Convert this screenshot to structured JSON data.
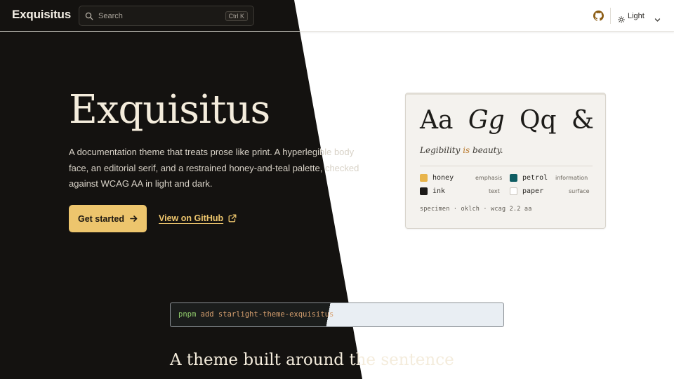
{
  "header": {
    "brand": "Exquisitus",
    "search": {
      "placeholder": "Search",
      "shortcut": "Ctrl K",
      "icon": "search-icon"
    },
    "github_icon": "github-icon",
    "theme_select": {
      "icon": "sun-icon",
      "value": "Light",
      "caret": "chevron-down-icon"
    }
  },
  "hero": {
    "title": "Exquisitus",
    "lede": "A documentation theme that treats prose like print. A hyperlegible body face, an editorial serif, and a restrained honey-and-teal palette, checked against WCAG AA in light and dark.",
    "primary_button": {
      "label": "Get started",
      "icon": "arrow-right-icon"
    },
    "secondary_link": {
      "label": "View on GitHub",
      "icon": "external-link-icon"
    }
  },
  "specimen": {
    "glyphs": [
      "Aa",
      "Gg",
      "Qq",
      "&"
    ],
    "tagline": {
      "pre": "Legibility ",
      "highlight": "is",
      "post": " beauty."
    },
    "swatches": [
      {
        "name": "honey",
        "role": "emphasis",
        "color": "#e8b44a"
      },
      {
        "name": "petrol",
        "role": "information",
        "color": "#0f5d63"
      },
      {
        "name": "ink",
        "role": "text",
        "color": "#1c1b18"
      },
      {
        "name": "paper",
        "role": "surface",
        "color": "#ffffff"
      }
    ],
    "footer": "specimen · oklch · wcag 2.2 aa"
  },
  "install": {
    "command_pm": "pnpm",
    "command_verb": "add",
    "command_pkg": "starlight-theme-exquisitus"
  },
  "section": {
    "title": "A theme built around the sentence"
  },
  "colors": {
    "dark_bg": "#141210",
    "light_bg": "#ffffff",
    "accent": "#edc56d",
    "honey_text": "#b9782a"
  }
}
